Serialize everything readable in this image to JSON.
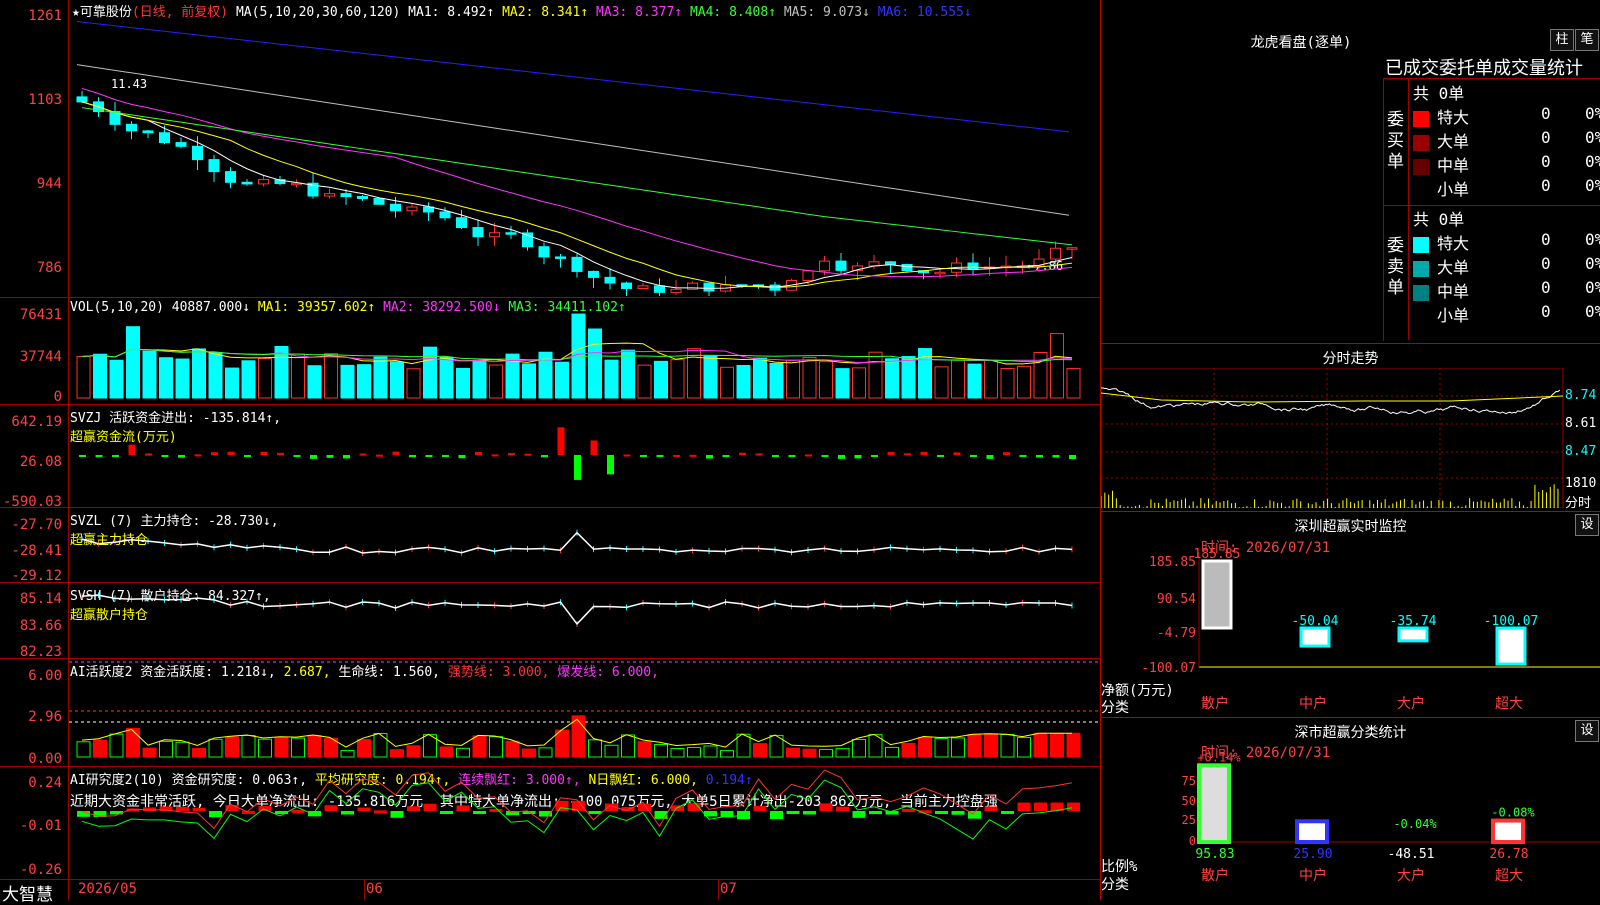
{
  "stock": {
    "name": "★可靠股份",
    "period": "(日线, 前复权)",
    "ma_label": "MA(5,10,20,30,60,120)",
    "ma1": "MA1: 8.492↑",
    "ma2": "MA2: 8.341↑",
    "ma3": "MA3: 8.377↑",
    "ma4": "MA4: 8.408↑",
    "ma5": "MA5: 9.073↓",
    "ma6": "MA6: 10.555↓",
    "high_marker": "11.43",
    "low_marker": "←7.86"
  },
  "price_axis": [
    "1261",
    "1103",
    "944",
    "786"
  ],
  "vol": {
    "label": "VOL(5,10,20)",
    "value": "40887.000↓",
    "ma1": "MA1: 39357.602↑",
    "ma2": "MA2: 38292.500↓",
    "ma3": "MA3: 34411.102↑",
    "axis": [
      "76431",
      "37744",
      "0"
    ]
  },
  "svzj": {
    "label": "SVZJ  活跃资金进出: -135.814↑,",
    "sub": "超赢资金流(万元)",
    "axis": [
      "642.19",
      "26.08",
      "-590.03"
    ]
  },
  "svzl": {
    "label": "SVZL (7) 主力持仓: -28.730↓,",
    "sub": "超赢主力持仓",
    "axis": [
      "-27.70",
      "-28.41",
      "-29.12"
    ]
  },
  "svsh": {
    "label": "SVSH (7) 散户持仓: 84.327↑,",
    "sub": "超赢散户持仓",
    "axis": [
      "85.14",
      "83.66",
      "82.23"
    ]
  },
  "ai1": {
    "label_a": "AI活跃度2 资金活跃度: 1.218↓,",
    "label_b": "2.687,",
    "label_c": "生命线: 1.560,",
    "label_d": "强势线: 3.000,",
    "label_e": "爆发线: 6.000,",
    "axis": [
      "6.00",
      "2.96",
      "0.00"
    ]
  },
  "ai2": {
    "label_a": "AI研究度2(10) 资金研究度: 0.063↑,",
    "label_b": "平均研究度: 0.194↑,",
    "label_c": "连续飘红: 3.000↑,",
    "label_d": "N日飘红: 6.000,",
    "label_e": "0.194↑",
    "comment": "近期大资金非常活跃, 今日大单净流出: -135.816万元, 其中特大单净流出: -100.075万元, 大单5日累计净出-203.862万元, 当前主力控盘强",
    "axis": [
      "0.24",
      "-0.01",
      "-0.26"
    ]
  },
  "date_axis": {
    "app": "大智慧",
    "d1": "2026/05",
    "d2": "06",
    "d3": "07"
  },
  "dragon": {
    "title": "龙虎看盘(逐单)",
    "btn1": "柱",
    "btn2": "笔",
    "header": "已成交委托单成交量统计",
    "buy_label": "委买单",
    "sell_label": "委卖单",
    "buy_total": "共 0单",
    "sell_total": "共 0单",
    "buy_rows": [
      {
        "name": "特大",
        "count": "0",
        "pct": "0%",
        "color": "#ff0000"
      },
      {
        "name": "大单",
        "count": "0",
        "pct": "0%",
        "color": "#990000"
      },
      {
        "name": "中单",
        "count": "0",
        "pct": "0%",
        "color": "#660000"
      },
      {
        "name": "小单",
        "count": "0",
        "pct": "0%",
        "color": "#000000"
      }
    ],
    "sell_rows": [
      {
        "name": "特大",
        "count": "0",
        "pct": "0%",
        "color": "#00ffff"
      },
      {
        "name": "大单",
        "count": "0",
        "pct": "0%",
        "color": "#00aaaa"
      },
      {
        "name": "中单",
        "count": "0",
        "pct": "0%",
        "color": "#008080"
      },
      {
        "name": "小单",
        "count": "0",
        "pct": "0%",
        "color": "#000000"
      }
    ]
  },
  "intraday": {
    "title": "分时走势",
    "axis": [
      "8.74",
      "8.61",
      "8.47"
    ],
    "vol_value": "1810",
    "vol_label": "分时"
  },
  "monitor": {
    "title": "深圳超赢实时监控",
    "set": "设",
    "time": "时间: 2026/07/31",
    "axis": [
      "185.85",
      "90.54",
      "-4.79",
      "-100.07"
    ],
    "unit": "净额(万元)",
    "cat": "分类",
    "bars": [
      {
        "name": "散户",
        "value": "185.85",
        "v": 185.85
      },
      {
        "name": "中户",
        "value": "-50.04",
        "v": -50.04
      },
      {
        "name": "大户",
        "value": "-35.74",
        "v": -35.74
      },
      {
        "name": "超大",
        "value": "-100.07",
        "v": -100.07
      }
    ]
  },
  "classify": {
    "title": "深市超赢分类统计",
    "set": "设",
    "time": "时间: 2026/07/31",
    "axis": [
      "75",
      "50",
      "25",
      "0"
    ],
    "unit": "比例%",
    "cat": "分类",
    "bars": [
      {
        "name": "散户",
        "top": "+0.14%",
        "bottom": "95.83",
        "v": 95.83,
        "color": "#33ff33"
      },
      {
        "name": "中户",
        "top": "",
        "bottom": "25.90",
        "v": 25.9,
        "color": "#3333ff"
      },
      {
        "name": "大户",
        "top": "-0.04%",
        "bottom": "-48.51",
        "v": 0,
        "color": "#00ffff"
      },
      {
        "name": "超大",
        "top": "-0.08%",
        "bottom": "26.78",
        "v": 26.78,
        "color": "#ff3333"
      }
    ]
  }
}
